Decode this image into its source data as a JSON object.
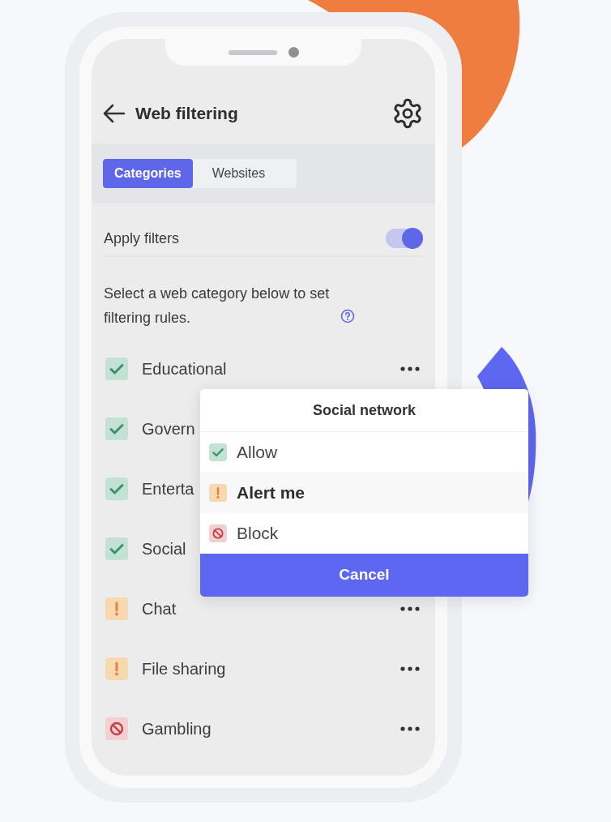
{
  "header": {
    "title": "Web filtering"
  },
  "tabs": [
    {
      "label": "Categories",
      "selected": true
    },
    {
      "label": "Websites",
      "selected": false
    }
  ],
  "apply_filters": {
    "label": "Apply filters",
    "on": true
  },
  "description": "Select a web category below to set filtering rules.",
  "categories": [
    {
      "name": "Educational",
      "kind": "allow",
      "menu_visible": true
    },
    {
      "name": "Govern",
      "kind": "allow",
      "menu_visible": false
    },
    {
      "name": "Enterta",
      "kind": "allow",
      "menu_visible": false
    },
    {
      "name": "Social",
      "kind": "allow",
      "menu_visible": false
    },
    {
      "name": "Chat",
      "kind": "alert",
      "menu_visible": true
    },
    {
      "name": "File sharing",
      "kind": "alert",
      "menu_visible": true
    },
    {
      "name": "Gambling",
      "kind": "block",
      "menu_visible": true
    }
  ],
  "popup": {
    "title": "Social network",
    "options": [
      {
        "label": "Allow",
        "kind": "allow",
        "selected": false
      },
      {
        "label": "Alert me",
        "kind": "alert",
        "selected": true
      },
      {
        "label": "Block",
        "kind": "block",
        "selected": false
      }
    ],
    "cancel": "Cancel"
  }
}
